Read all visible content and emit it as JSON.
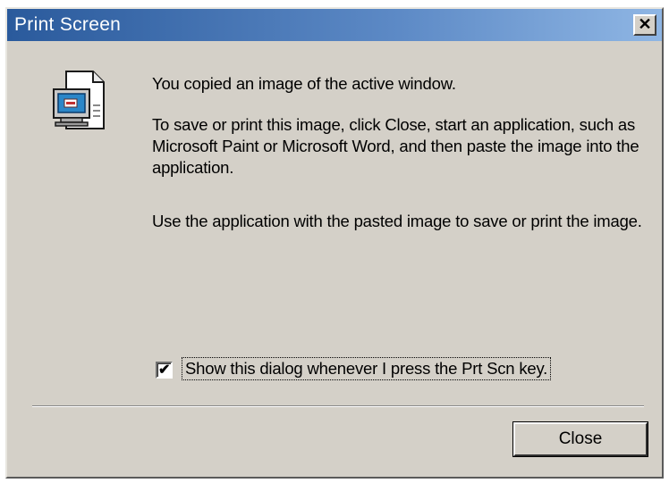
{
  "window": {
    "title": "Print Screen",
    "close_glyph": "✕",
    "icon": "screenshot-icon"
  },
  "message": {
    "line1": "You copied an image of the active window.",
    "line2": "To save or print this image, click Close, start an application, such as Microsoft Paint or Microsoft Word, and then paste the image into the application.",
    "line3": "Use the application with the pasted image to save or print the image."
  },
  "checkbox": {
    "label": "Show this dialog whenever I press the Prt Scn key.",
    "checked": true,
    "mark": "✔"
  },
  "buttons": {
    "close_label": "Close"
  },
  "colors": {
    "title_bar_start": "#2a5a9c",
    "title_bar_end": "#8fb6e4",
    "dialog_face": "#d4d0c8"
  }
}
